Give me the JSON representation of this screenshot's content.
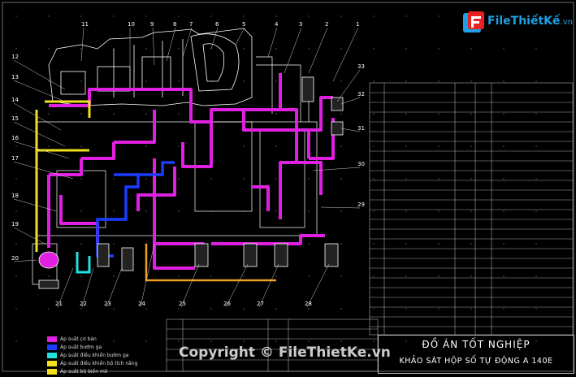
{
  "logo": {
    "name": "FileThiếtKế",
    "domain": ".vn"
  },
  "watermark": "Copyright © FileThietKe.vn",
  "title_block": {
    "main": "ĐỒ ÁN TỐT NGHIỆP",
    "sub": "KHẢO SÁT HỘP SỐ TỰ ĐỘNG A 140E"
  },
  "callouts": [
    "1",
    "2",
    "3",
    "4",
    "5",
    "6",
    "7",
    "8",
    "9",
    "10",
    "11",
    "12",
    "13",
    "14",
    "15",
    "16",
    "17",
    "18",
    "19",
    "20",
    "21",
    "22",
    "23",
    "24",
    "25",
    "26",
    "27",
    "28",
    "29",
    "30",
    "31",
    "32",
    "33"
  ],
  "legend": [
    {
      "label": "Áp suất cơ bản",
      "color": "#e020e0"
    },
    {
      "label": "Áp suất bướm ga",
      "color": "#1a3cff"
    },
    {
      "label": "Áp suất điều khiển bướm ga",
      "color": "#20e0e0"
    },
    {
      "label": "Áp suất điều khiển bộ tích năng",
      "color": "#f0e020"
    },
    {
      "label": "Áp suất bộ biến mô",
      "color": "#f0e020"
    }
  ],
  "colors": {
    "main_pressure": "#e020e0",
    "throttle": "#1a3cff",
    "throttle_ctrl": "#20e0e0",
    "accumulator": "#f0e020",
    "lubrication": "#f0a020",
    "line": "#ffffff"
  }
}
